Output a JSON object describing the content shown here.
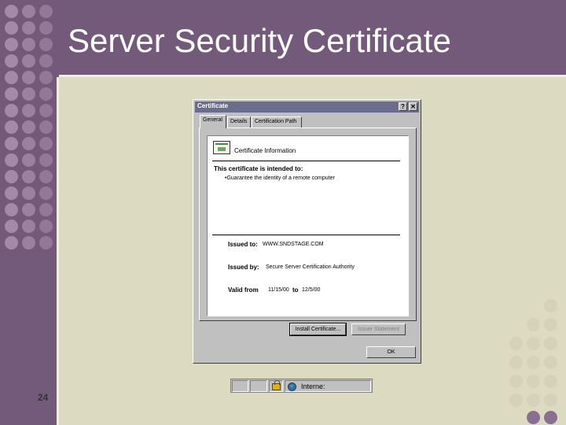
{
  "slide": {
    "title": "Server Security Certificate",
    "number": "24",
    "colors": {
      "band": "#745a7a",
      "background": "#dcdac0",
      "dot_band": "#a48aa8",
      "dot_light": "#d6d2ba",
      "dot_dark": "#8a7090"
    }
  },
  "dialog": {
    "title": "Certificate",
    "help_glyph": "?",
    "close_glyph": "✕",
    "tabs": [
      {
        "label": "General",
        "active": true
      },
      {
        "label": "Details",
        "active": false
      },
      {
        "label": "Certification Path",
        "active": false
      }
    ],
    "info_title": "Certificate Information",
    "intended_label": "This certificate is intended to:",
    "intended_items": [
      "•Guarantee the identity of a remote computer"
    ],
    "issued_to_label": "Issued to:",
    "issued_to_value": "WWW.SNDSTAGE.COM",
    "issued_by_label": "Issued by:",
    "issued_by_value": "Secure Server Certification Authority",
    "valid_from_label": "Valid from",
    "valid_from_value": "11/15/00",
    "valid_to_label": "to",
    "valid_to_value": "12/5/00",
    "install_button": "Install Certificate...",
    "issuer_button": "Issuer Statement",
    "ok_button": "OK"
  },
  "statusbar": {
    "zone_text": "Interne:",
    "icons": [
      "lock-icon",
      "globe-icon"
    ]
  }
}
